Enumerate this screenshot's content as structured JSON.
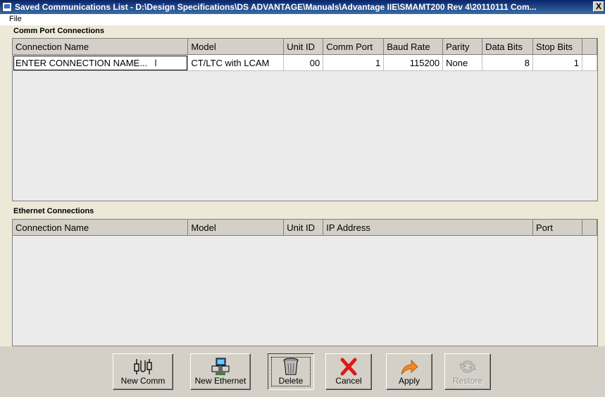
{
  "window": {
    "title": "Saved Communications List - D:\\Design Specifications\\DS ADVANTAGE\\Manuals\\Advantage IIE\\SMAMT200 Rev 4\\20110111 Com...",
    "close_label": "X"
  },
  "menu": {
    "file": "File"
  },
  "comm": {
    "section_title": "Comm Port Connections",
    "columns": [
      "Connection Name",
      "Model",
      "Unit ID",
      "Comm Port",
      "Baud Rate",
      "Parity",
      "Data Bits",
      "Stop Bits"
    ],
    "rows": [
      {
        "name": "ENTER CONNECTION NAME...",
        "model": "CT/LTC with LCAM",
        "unit_id": "00",
        "comm_port": "1",
        "baud_rate": "115200",
        "parity": "None",
        "data_bits": "8",
        "stop_bits": "1"
      }
    ]
  },
  "ethernet": {
    "section_title": "Ethernet Connections",
    "columns": [
      "Connection Name",
      "Model",
      "Unit ID",
      "IP Address",
      "Port"
    ]
  },
  "buttons": {
    "new_comm": "New Comm",
    "new_ethernet": "New Ethernet",
    "delete": "Delete",
    "cancel": "Cancel",
    "apply": "Apply",
    "restore": "Restore"
  },
  "colors": {
    "titlebar": "#0a246a",
    "panel": "#d4d0c8",
    "grid_bg": "#ebebeb",
    "cancel_red": "#e01818",
    "apply_orange": "#f08a24"
  }
}
